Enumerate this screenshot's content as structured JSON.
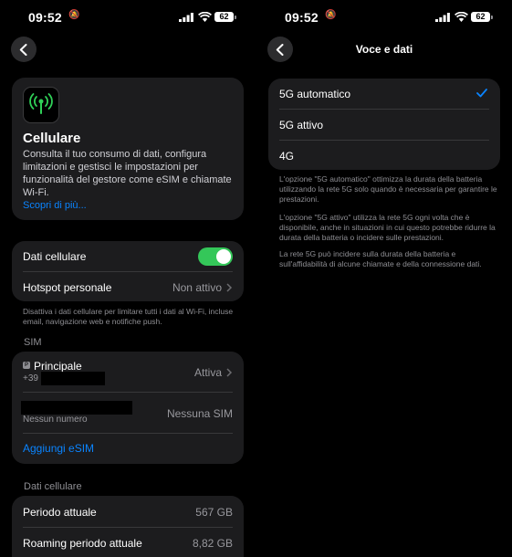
{
  "status_bar": {
    "time": "09:52",
    "battery": "62"
  },
  "cellular_page": {
    "title": "Cellulare",
    "description": "Consulta il tuo consumo di dati, configura limitazioni e gestisci le impostazioni per funzionalità del gestore come eSIM e chiamate Wi-Fi.",
    "learn_more": "Scopri di più...",
    "cellular_data_label": "Dati cellulare",
    "hotspot_label": "Hotspot personale",
    "hotspot_value": "Non attivo",
    "data_note": "Disattiva i dati cellulare per limitare tutti i dati al Wi-Fi, incluse email, navigazione web e notifiche push.",
    "sim_header": "SIM",
    "sim_primary_name": "Principale",
    "sim_primary_badge": "P",
    "sim_primary_number_prefix": "+39",
    "sim_primary_status": "Attiva",
    "sim_secondary_sub": "Nessun numero",
    "sim_secondary_status": "Nessuna SIM",
    "add_esim": "Aggiungi eSIM",
    "usage_header": "Dati cellulare",
    "current_period_label": "Periodo attuale",
    "current_period_value": "567 GB",
    "roaming_label": "Roaming periodo attuale",
    "roaming_value": "8,82 GB"
  },
  "voice_data_page": {
    "title": "Voce e dati",
    "options": [
      {
        "label": "5G automatico",
        "selected": true
      },
      {
        "label": "5G attivo",
        "selected": false
      },
      {
        "label": "4G",
        "selected": false
      }
    ],
    "note1": "L'opzione \"5G automatico\" ottimizza la durata della batteria utilizzando la rete 5G solo quando è necessaria per garantire le prestazioni.",
    "note2": "L'opzione \"5G attivo\" utilizza la rete 5G ogni volta che è disponibile, anche in situazioni in cui questo potrebbe ridurre la durata della batteria o incidere sulle prestazioni.",
    "note3": "La rete 5G può incidere sulla durata della batteria e sull'affidabilità di alcune chiamate e della connessione dati."
  },
  "colors": {
    "accent": "#0a84ff",
    "toggle_on": "#34c759",
    "card": "#1c1c1e",
    "icon_green": "#30d158"
  }
}
